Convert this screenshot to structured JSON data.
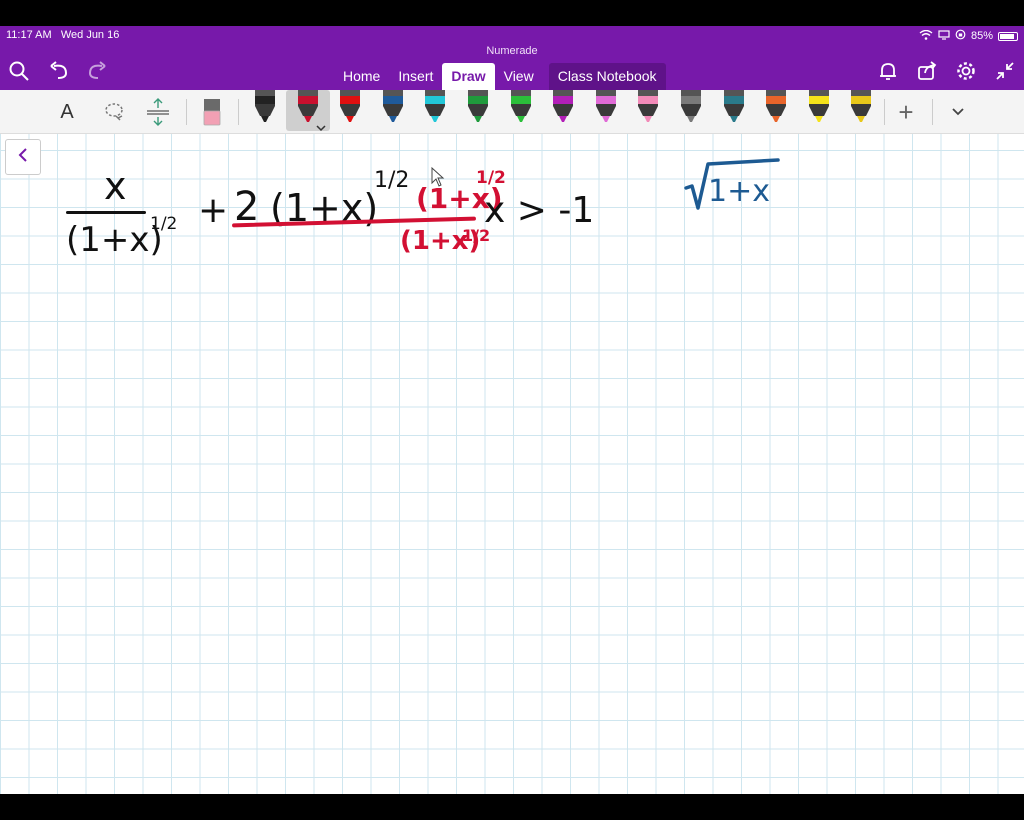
{
  "status": {
    "time": "11:17 AM",
    "date": "Wed Jun 16",
    "battery": "85%"
  },
  "app": {
    "title": "Numerade"
  },
  "tabs": [
    {
      "label": "Home"
    },
    {
      "label": "Insert"
    },
    {
      "label": "Draw",
      "active": true
    },
    {
      "label": "View"
    },
    {
      "label": "Class Notebook"
    }
  ],
  "toolbar": {
    "text_tool_label": "A",
    "add_label": "+",
    "pens": [
      "#222222",
      "#c8102e",
      "#e01010",
      "#1f5a9a",
      "#22c7d8",
      "#1f9a3c",
      "#2bbf3a",
      "#b21fb8",
      "#e06ad6",
      "#f28ab8",
      "#7a7a7a",
      "#2a7a8a",
      "#e8642a",
      "#f4e21a",
      "#e8c81a"
    ]
  },
  "ink": {
    "frac1_num": "x",
    "frac1_den": "(1+x)",
    "frac1_exp": "1/2",
    "plus": "+",
    "two": "2",
    "paren": "(1+x)",
    "exp_half": "1/2",
    "red_num": "(1+x)",
    "red_exp": "1/2",
    "red_den": "(1+x)",
    "red_den_exp": "1/2",
    "condition": "x > -1",
    "blue_radicand": "1+x"
  },
  "colors": {
    "accent": "#7719aa",
    "ink_black": "#111111",
    "ink_red": "#d21033",
    "ink_blue": "#1d5a92"
  }
}
